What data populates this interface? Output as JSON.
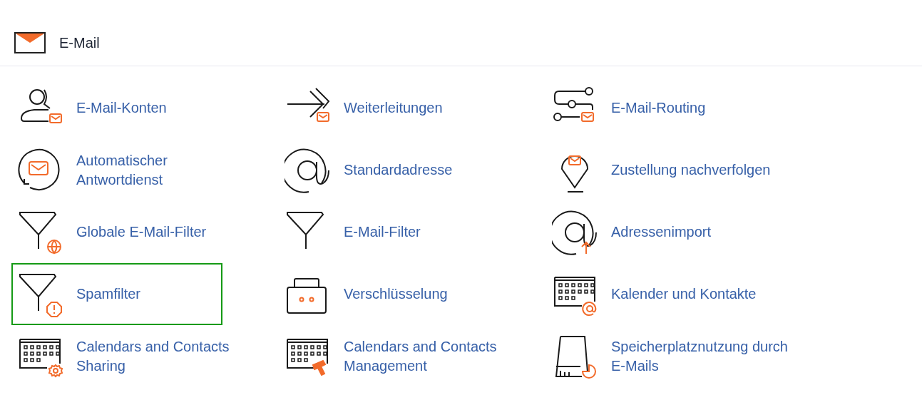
{
  "section": {
    "title": "E-Mail"
  },
  "items": [
    {
      "label": "E-Mail-Konten",
      "kind": "accounts",
      "selected": false
    },
    {
      "label": "Weiterleitungen",
      "kind": "forward",
      "selected": false
    },
    {
      "label": "E-Mail-Routing",
      "kind": "routing",
      "selected": false
    },
    {
      "label": "Automatischer Antwortdienst",
      "kind": "autoreply",
      "selected": false
    },
    {
      "label": "Standardadresse",
      "kind": "at",
      "selected": false
    },
    {
      "label": "Zustellung nachverfolgen",
      "kind": "track",
      "selected": false
    },
    {
      "label": "Globale E-Mail-Filter",
      "kind": "globalfilter",
      "selected": false
    },
    {
      "label": "E-Mail-Filter",
      "kind": "filter",
      "selected": false
    },
    {
      "label": "Adressenimport",
      "kind": "import",
      "selected": false
    },
    {
      "label": "Spamfilter",
      "kind": "spamfilter",
      "selected": true
    },
    {
      "label": "Verschlüsselung",
      "kind": "encryption",
      "selected": false
    },
    {
      "label": "Kalender und Kontakte",
      "kind": "calendarat",
      "selected": false
    },
    {
      "label": "Calendars and Contacts Sharing",
      "kind": "calendarshare",
      "selected": false
    },
    {
      "label": "Calendars and Contacts Management",
      "kind": "calendarmanage",
      "selected": false
    },
    {
      "label": "Speicherplatznutzung durch E-Mails",
      "kind": "disk",
      "selected": false
    }
  ]
}
